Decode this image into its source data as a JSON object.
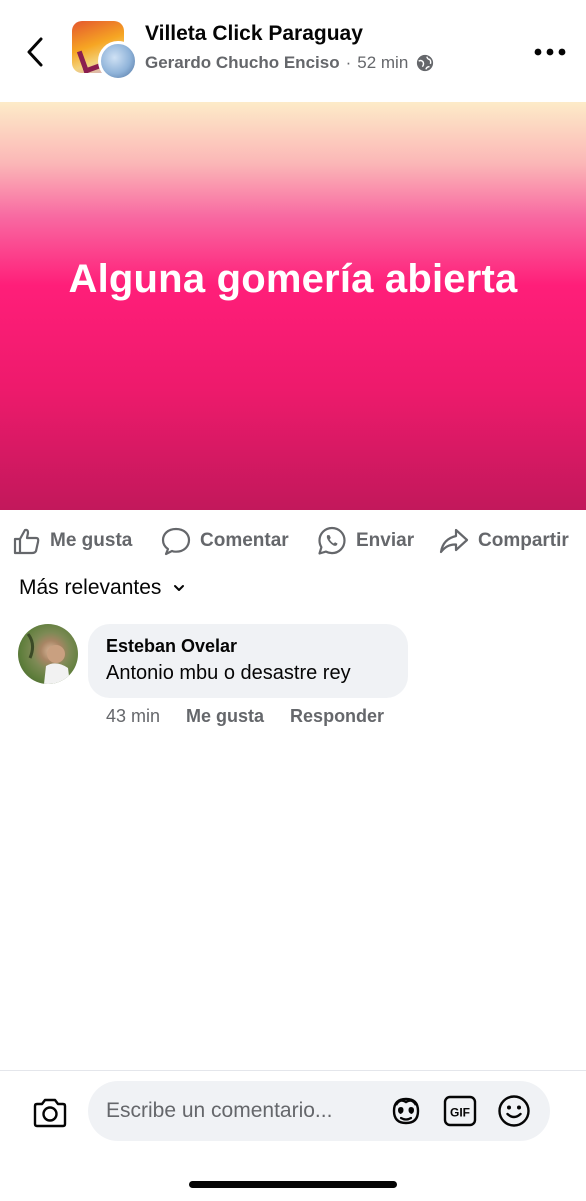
{
  "header": {
    "group_name": "Villeta Click Paraguay",
    "author": "Gerardo Chucho Enciso",
    "separator": "·",
    "time": "52 min",
    "privacy_icon": "globe-icon"
  },
  "post": {
    "text": "Alguna gomería abierta",
    "background_colors": [
      "#fdebc8",
      "#ff1e79",
      "#c2185b"
    ]
  },
  "actions": {
    "like": "Me gusta",
    "comment": "Comentar",
    "send": "Enviar",
    "share": "Compartir"
  },
  "comments_sort": {
    "label": "Más relevantes"
  },
  "comments": [
    {
      "author": "Esteban Ovelar",
      "text": "Antonio mbu o desastre rey",
      "time": "43 min",
      "like_label": "Me gusta",
      "reply_label": "Responder"
    }
  ],
  "composer": {
    "placeholder": "Escribe un comentario..."
  },
  "colors": {
    "secondary_text": "#65676b",
    "primary_text": "#050505",
    "bubble_bg": "#f0f2f5"
  }
}
